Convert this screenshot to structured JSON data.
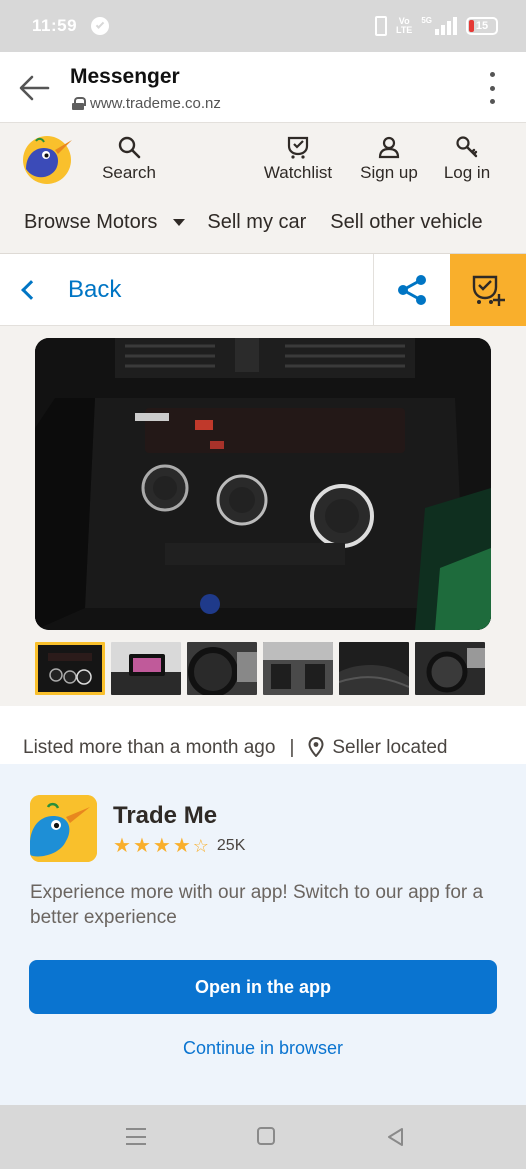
{
  "status_bar": {
    "time": "11:59",
    "volte_top": "Vo",
    "volte_bottom": "LTE",
    "network": "5G",
    "battery": "15"
  },
  "browser": {
    "title": "Messenger",
    "url": "www.trademe.co.nz"
  },
  "site_header": {
    "search_label": "Search",
    "watchlist_label": "Watchlist",
    "signup_label": "Sign up",
    "login_label": "Log in",
    "browse_motors": "Browse Motors",
    "sell_my_car": "Sell my car",
    "sell_other_vehicle": "Sell other vehicle"
  },
  "back_bar": {
    "back_label": "Back"
  },
  "gallery": {
    "selected_index": 0,
    "thumbnail_count": 6
  },
  "listing": {
    "listed_text": "Listed more than a month ago",
    "separator": "|",
    "seller_text": "Seller located"
  },
  "app_banner": {
    "app_name": "Trade Me",
    "rating_stars": 4,
    "rating_count": "25K",
    "message": "Experience more with our app! Switch to our app for a better experience",
    "open_button": "Open in the app",
    "continue_link": "Continue in browser"
  },
  "colors": {
    "accent_blue": "#0075c4",
    "button_blue": "#0a74d0",
    "watchlist_yellow": "#f9af2c",
    "background": "#f4f2ef"
  }
}
